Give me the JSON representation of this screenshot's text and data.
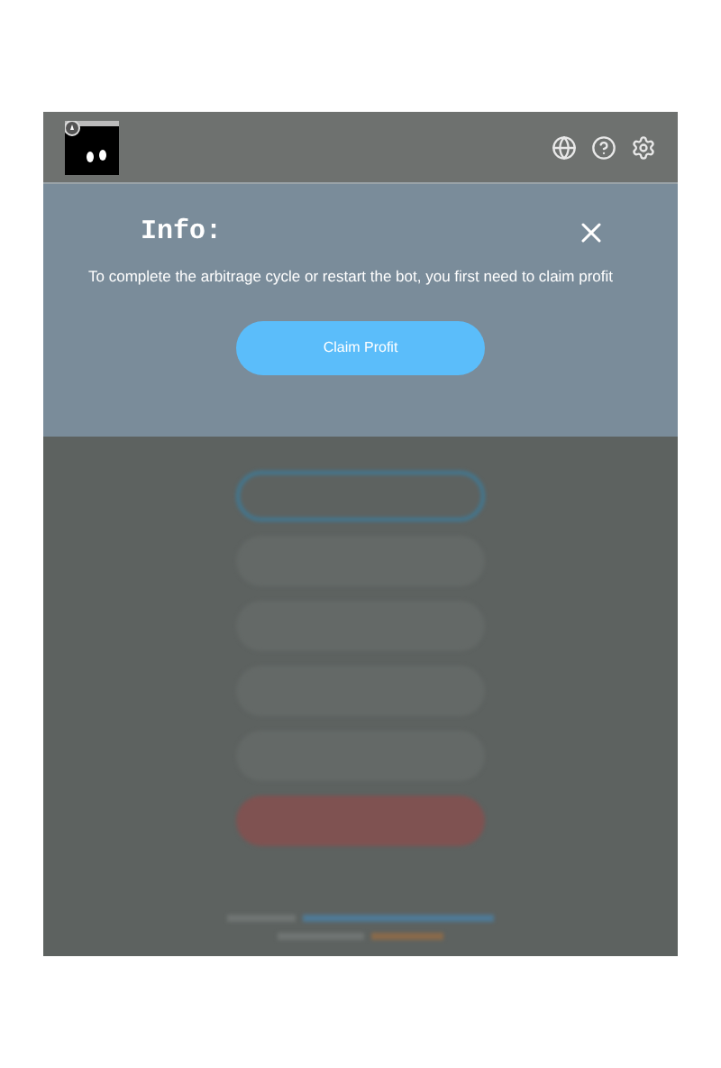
{
  "info": {
    "title": "Info:",
    "message": "To complete the arbitrage cycle or restart the bot, you first need to claim profit",
    "button": "Claim Profit"
  },
  "background_buttons": [
    {
      "kind": "outline"
    },
    {
      "kind": "plain"
    },
    {
      "kind": "plain"
    },
    {
      "kind": "plain"
    },
    {
      "kind": "plain"
    },
    {
      "kind": "danger"
    }
  ]
}
